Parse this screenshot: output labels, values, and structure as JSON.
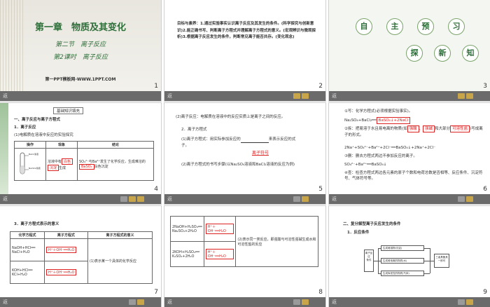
{
  "slides": [
    {
      "num": "1",
      "chapter": "第一章　物质及其变化",
      "section": "第二节　离子反应",
      "lesson": "第2课时　离子反应",
      "site": "第一PPT模板网-WWW.1PPT.COM"
    },
    {
      "num": "2",
      "text": "目标与素养：1.通过实验事实认识离子反应及其发生的条件。(科学探究与创新意识)2.能正确书写、判断离子方程式并理解离子方程式的意义。(宏观辨识与微观探析)3.根据离子反应发生的条件，判断常见离子能否共存。(变化观念)"
    },
    {
      "num": "3",
      "chars1": [
        "自",
        "主",
        "预",
        "习"
      ],
      "chars2": [
        "探",
        "新",
        "知"
      ]
    },
    {
      "num": "4",
      "badge": "基础知识填充",
      "h1": "一、离子反应与离子方程式",
      "h2": "1．离子反应",
      "h3": "(1)电解质在溶液中反应的实验探究",
      "cols": [
        "操作",
        "现象",
        "结论"
      ],
      "phenomenon_a": "溶液中有",
      "phenomenon_b": "白色",
      "phenomenon_c": "沉淀",
      "phenomenon_d": "生成",
      "conclusion_a": "SO₄²⁻与Ba²⁺发生了化学反应，生成难溶的",
      "conclusion_b": "BaSO₄",
      "conclusion_c": "白色沉淀",
      "tube_label_a": "BaCl₂溶液",
      "tube_label_b": "Na₂SO₄溶液"
    },
    {
      "num": "5",
      "l1": "(2)离子反应：电解质在溶液中的反应实质上是离子之间的反应。",
      "l2": "2．离子方程式",
      "l3a": "(1)离子方程式：用实际参加反应的",
      "l3b": "来表示反应的式",
      "l3c": "子。",
      "ans1": "离子符号",
      "l4": "(2)离子方程式的书写步骤(以Na₂SO₄溶液和BaCl₂溶液的反应为例)"
    },
    {
      "num": "6",
      "l1": "①写：化学方程式(必须根据实验事实)。",
      "eq1a": "Na₂SO₄+BaCl₂══",
      "eq1b": "BaSO₄↓+2NaCl",
      "l2a": "②拆：把易溶于水且易电离的物质(如",
      "ans_a": "强酸",
      "ans_b": "强碱",
      "l2b": "和大部分",
      "ans_c": "可溶性盐",
      "l2c": ")写成离子的形式。",
      "eq2": "2Na⁺+SO₄²⁻+Ba²⁺+2Cl⁻══BaSO₄↓+2Na⁺+2Cl⁻",
      "l3": "③删：删去方程式两边不参加反应的离子。",
      "eq3": "SO₄²⁻+Ba²⁺══BaSO₄↓",
      "l4": "④查：检查方程式两边各元素的原子个数和电荷总数是否相等、反应条件、沉淀符号、气体符号等。"
    },
    {
      "num": "7",
      "title": "3．离子方程式表示的意义",
      "cols": [
        "化学方程式",
        "离子方程式",
        "离子方程式的意义"
      ],
      "r1a": "NaOH+HCl══",
      "r1b": "NaCl+H₂O",
      "r2a": "KOH+HCl══",
      "r2b": "KCl+H₂O",
      "ion": "H⁺＋OH⁻══H₂O",
      "meaning": "(1)表示某一个具体的化学反应"
    },
    {
      "num": "8",
      "r1a": "2NaOH+H₂SO₄══",
      "r1b": "Na₂SO₄+2H₂O",
      "r2a": "2KOH+H₂SO₄══",
      "r2b": "K₂SO₄+2H₂O",
      "ion": "H⁺＋OH⁻══H₂O",
      "meaning": "(2)表示同一类反应，即强酸与可溶性强碱生成水和可溶性盐的反应"
    },
    {
      "num": "9",
      "title": "二、复分解型离子反应发生的条件",
      "sub": "1．反应条件",
      "root_a": "离子反应",
      "root_b": "条件",
      "items": [
        "生成难溶物(沉淀)",
        "生成难电离的物质(水)",
        "生成挥发性的物质(气体)"
      ],
      "result": "三者具备其一即可"
    }
  ],
  "footer_left": "返"
}
